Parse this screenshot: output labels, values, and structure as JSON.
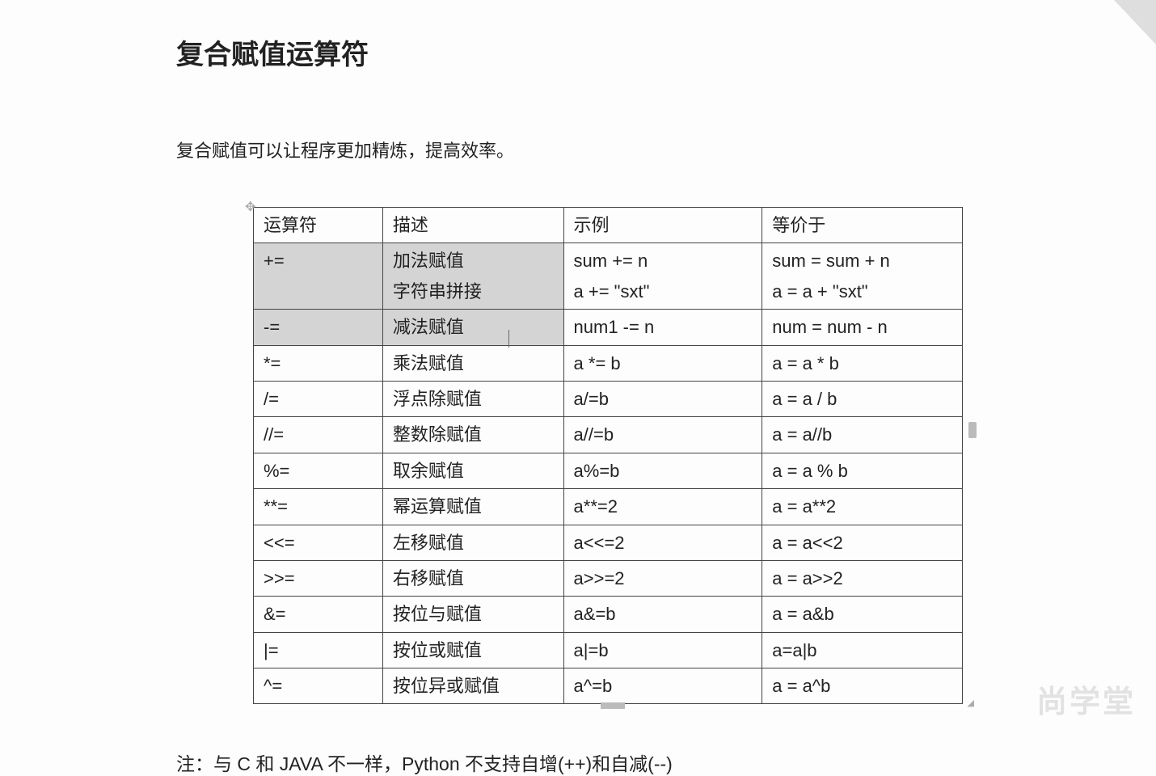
{
  "title": "复合赋值运算符",
  "intro": "复合赋值可以让程序更加精炼，提高效率。",
  "headers": {
    "op": "运算符",
    "desc": "描述",
    "ex": "示例",
    "eq": "等价于"
  },
  "rows": [
    {
      "op": "+=",
      "desc1": "加法赋值",
      "desc2": "字符串拼接",
      "ex1": "sum += n",
      "ex2": "a   +=   \"sxt\"",
      "eq1": "sum = sum + n",
      "eq2": "a   =   a +   \"sxt\"",
      "shaded": true,
      "multi": true
    },
    {
      "op": "-=",
      "desc": "减法赋值",
      "ex": "num1   -= n",
      "eq": "num = num - n",
      "shaded": true
    },
    {
      "op": "*=",
      "desc": "乘法赋值",
      "ex": "a *= b",
      "eq": "a = a * b"
    },
    {
      "op": "/=",
      "desc": "浮点除赋值",
      "ex": "a/=b",
      "eq": "a = a / b"
    },
    {
      "op": "//=",
      "desc": "整数除赋值",
      "ex": "a//=b",
      "eq": "a = a//b"
    },
    {
      "op": "%=",
      "desc": "取余赋值",
      "ex": "a%=b",
      "eq": "a = a % b"
    },
    {
      "op": "**=",
      "desc": "幂运算赋值",
      "ex": "a**=2",
      "eq": "a = a**2"
    },
    {
      "op": "<<=",
      "desc": "左移赋值",
      "ex": "a<<=2",
      "eq": "a = a<<2"
    },
    {
      "op": ">>=",
      "desc": "右移赋值",
      "ex": "a>>=2",
      "eq": "a = a>>2"
    },
    {
      "op": "&=",
      "desc": "按位与赋值",
      "ex": "a&=b",
      "eq": "a = a&b"
    },
    {
      "op": "|=",
      "desc": "按位或赋值",
      "ex": "a|=b",
      "eq": "a=a|b"
    },
    {
      "op": "^=",
      "desc": "按位异或赋值",
      "ex": "a^=b",
      "eq": "a = a^b"
    }
  ],
  "note": "注：与 C 和 JAVA 不一样，Python 不支持自增(++)和自减(--)",
  "watermark": "尚学堂"
}
